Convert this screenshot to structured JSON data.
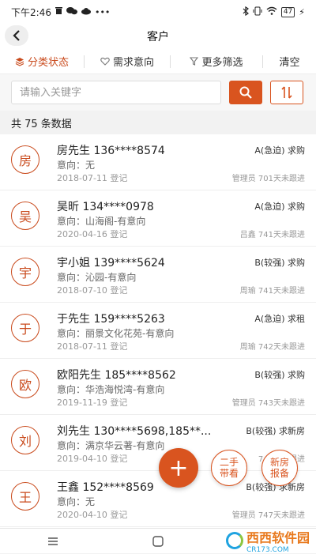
{
  "status_bar": {
    "time": "下午2:46",
    "left_icons": [
      "trash-icon",
      "wechat-icon",
      "cloud-icon",
      "dots-icon"
    ],
    "right_icons": [
      "bluetooth-icon",
      "vibrate-icon",
      "wifi-icon"
    ],
    "battery": "47",
    "charging": "⚡"
  },
  "header": {
    "title": "客户"
  },
  "filters": [
    {
      "label": "分类状态",
      "icon": "stack-icon"
    },
    {
      "label": "需求意向",
      "icon": "heart-icon"
    },
    {
      "label": "更多筛选",
      "icon": "funnel-icon"
    },
    {
      "label": "清空"
    }
  ],
  "search": {
    "placeholder": "请输入关键字",
    "value": ""
  },
  "count_label": "共 75 条数据",
  "customers": [
    {
      "avatar": "房",
      "name": "房先生 136****8574",
      "intent": "意向：无",
      "date": "2018-07-11 登记",
      "level": "A(急迫) 求购",
      "follow": "管理员  701天未跟进"
    },
    {
      "avatar": "吴",
      "name": "吴昕 134****0978",
      "intent": "意向：山海阁-有意向",
      "date": "2020-04-16 登记",
      "level": "A(急迫) 求购",
      "follow": "吕鑫  741天未跟进"
    },
    {
      "avatar": "宇",
      "name": "宇小姐 139****5624",
      "intent": "意向：沁园-有意向",
      "date": "2018-07-10 登记",
      "level": "B(较强) 求购",
      "follow": "周瑜  741天未跟进"
    },
    {
      "avatar": "于",
      "name": "于先生 159****5263",
      "intent": "意向：丽景文化花苑-有意向",
      "date": "2018-07-11 登记",
      "level": "A(急迫) 求租",
      "follow": "周瑜  742天未跟进"
    },
    {
      "avatar": "欧",
      "name": "欧阳先生 185****8562",
      "intent": "意向：华浩海悦湾-有意向",
      "date": "2019-11-19 登记",
      "level": "B(较强) 求购",
      "follow": "管理员  743天未跟进"
    },
    {
      "avatar": "刘",
      "name": "刘先生 130****5698,185**...",
      "intent": "意向：满京华云著-有意向",
      "date": "2019-04-10 登记",
      "level": "B(较强) 求新房",
      "follow": "743天未跟进"
    },
    {
      "avatar": "王",
      "name": "王鑫 152****8569",
      "intent": "意向：无",
      "date": "2020-04-10 登记",
      "level": "B(较强) 求新房",
      "follow": "管理员  747天未跟进"
    }
  ],
  "fab": {
    "add_symbol": "+",
    "second_hand": [
      "二手",
      "带看"
    ],
    "new_house": [
      "新房",
      "报备"
    ]
  },
  "watermark": {
    "text": "西西软件园",
    "sub": "CR173.COM"
  },
  "colors": {
    "accent": "#d9541f",
    "text": "#333333",
    "muted": "#999999"
  }
}
